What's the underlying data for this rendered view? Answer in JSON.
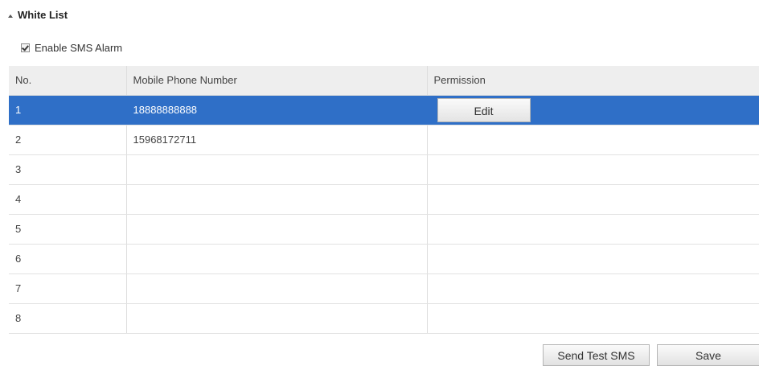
{
  "section": {
    "title": "White List"
  },
  "enable_sms": {
    "label": "Enable SMS Alarm",
    "checked": true
  },
  "table": {
    "columns": [
      "No.",
      "Mobile Phone Number",
      "Permission"
    ],
    "selected_row": 0,
    "rows": [
      {
        "no": "1",
        "phone": "18888888888",
        "permission": "Edit"
      },
      {
        "no": "2",
        "phone": "15968172711",
        "permission": ""
      },
      {
        "no": "3",
        "phone": "",
        "permission": ""
      },
      {
        "no": "4",
        "phone": "",
        "permission": ""
      },
      {
        "no": "5",
        "phone": "",
        "permission": ""
      },
      {
        "no": "6",
        "phone": "",
        "permission": ""
      },
      {
        "no": "7",
        "phone": "",
        "permission": ""
      },
      {
        "no": "8",
        "phone": "",
        "permission": ""
      }
    ]
  },
  "buttons": {
    "send_test_sms": "Send Test SMS",
    "save": "Save"
  },
  "colors": {
    "selected_row": "#2f6fc7",
    "header_bg": "#eeeeee"
  }
}
